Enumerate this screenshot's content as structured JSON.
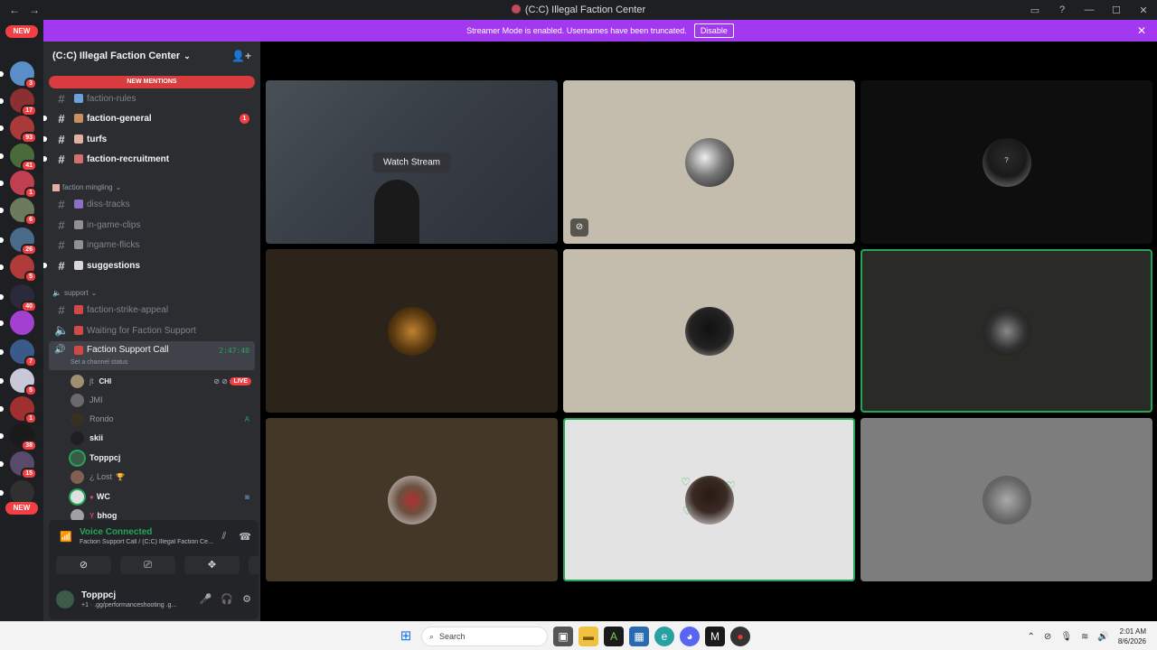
{
  "window": {
    "title": "(C:C) Illegal Faction Center"
  },
  "banner": {
    "text": "Streamer Mode is enabled. Usernames have been truncated.",
    "button": "Disable"
  },
  "guilds": {
    "new_top": "NEW",
    "new_bottom": "NEW",
    "items": [
      {
        "badge": "3",
        "color": "#5a8ec8"
      },
      {
        "badge": "17",
        "color": "#8a3030"
      },
      {
        "badge": "93",
        "color": "#a83a3a"
      },
      {
        "badge": "41",
        "color": "#4a6a3a"
      },
      {
        "badge": "1",
        "color": "#c04050"
      },
      {
        "badge": "6",
        "color": "#6a7a5a"
      },
      {
        "badge": "26",
        "color": "#4a6a8a"
      },
      {
        "badge": "5",
        "color": "#b03a3a"
      },
      {
        "badge": "40",
        "color": "#2a2a3a"
      },
      {
        "badge": "",
        "color": "#a440d0"
      },
      {
        "badge": "7",
        "color": "#3a5a8a"
      },
      {
        "badge": "5",
        "color": "#c8c8d8"
      },
      {
        "badge": "1",
        "color": "#a03030"
      },
      {
        "badge": "38",
        "color": "#1a1a1a"
      },
      {
        "badge": "15",
        "color": "#5a4a6a"
      },
      {
        "badge": "",
        "color": "#303030"
      }
    ]
  },
  "sidebar": {
    "server_name": "(C:C) Illegal Faction Center",
    "new_mentions": "NEW MENTIONS",
    "channels_top": [
      {
        "name": "faction-rules",
        "unread": false,
        "badge": ""
      },
      {
        "name": "faction-general",
        "unread": true,
        "badge": "1"
      },
      {
        "name": "turfs",
        "unread": true,
        "badge": ""
      },
      {
        "name": "faction-recruitment",
        "unread": true,
        "badge": ""
      }
    ],
    "category_mingling": "faction mingling",
    "channels_mingling": [
      {
        "name": "diss-tracks",
        "unread": false
      },
      {
        "name": "in-game-clips",
        "unread": false
      },
      {
        "name": "ingame-flicks",
        "unread": false
      },
      {
        "name": "suggestions",
        "unread": true
      }
    ],
    "category_support": "support",
    "channels_support": [
      {
        "name": "faction-strike-appeal"
      },
      {
        "name": "Waiting for Faction Support"
      }
    ],
    "voice_channel": {
      "name": "Faction Support Call",
      "timer": "2:47:40",
      "status": "Set a channel status"
    },
    "members": [
      {
        "name": "jt",
        "tag": "CHI",
        "live": "LIVE",
        "bold": false
      },
      {
        "name": "JMI",
        "bold": false
      },
      {
        "name": "Rondo",
        "bold": false
      },
      {
        "name": "skii",
        "bold": true
      },
      {
        "name": "Topppcj",
        "bold": true
      },
      {
        "name": "¿ Lost",
        "bold": false
      },
      {
        "name": "WC",
        "bold": true
      },
      {
        "name": "bhog",
        "bold": true
      }
    ]
  },
  "voice_panel": {
    "status": "Voice Connected",
    "channel": "Faction Support Call / (C:C) Illegal Faction Ce..."
  },
  "user": {
    "name": "Topppcj",
    "sub": "+1 · .gg/performanceshooting .g..."
  },
  "stage": {
    "watch_label": "Watch Stream",
    "unknown_avatar": "?"
  },
  "taskbar": {
    "search": "Search",
    "time": "2:01 AM",
    "date": "8/6/2026"
  }
}
